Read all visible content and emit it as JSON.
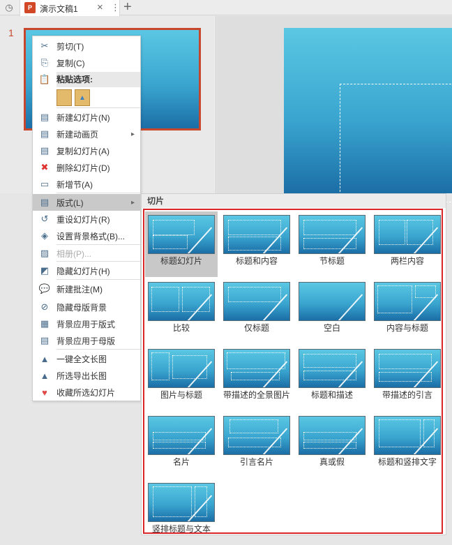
{
  "tabbar": {
    "doc_title": "演示文稿1",
    "close": "×",
    "more": "⋮",
    "new_tab": "+"
  },
  "slide_panel": {
    "slide_number": "1"
  },
  "context_menu": {
    "items": [
      {
        "label": "剪切(T)",
        "icon": "scissors-icon"
      },
      {
        "label": "复制(C)",
        "icon": "copy-icon"
      },
      {
        "label": "粘贴选项:",
        "icon": "paste-icon"
      },
      {
        "label": "新建幻灯片(N)",
        "icon": "new-slide-icon"
      },
      {
        "label": "新建动画页",
        "icon": "new-animation-page-icon"
      },
      {
        "label": "复制幻灯片(A)",
        "icon": "duplicate-slide-icon"
      },
      {
        "label": "删除幻灯片(D)",
        "icon": "delete-slide-icon"
      },
      {
        "label": "新增节(A)",
        "icon": "add-section-icon"
      },
      {
        "label": "版式(L)",
        "icon": "layout-icon"
      },
      {
        "label": "重设幻灯片(R)",
        "icon": "reset-slide-icon"
      },
      {
        "label": "设置背景格式(B)...",
        "icon": "format-background-icon"
      },
      {
        "label": "相册(P)...",
        "icon": "photo-album-icon"
      },
      {
        "label": "隐藏幻灯片(H)",
        "icon": "hide-slide-icon"
      },
      {
        "label": "新建批注(M)",
        "icon": "new-comment-icon"
      },
      {
        "label": "隐藏母版背景",
        "icon": "hide-master-bg-icon"
      },
      {
        "label": "背景应用于版式",
        "icon": "apply-bg-layout-icon"
      },
      {
        "label": "背景应用于母版",
        "icon": "apply-bg-master-icon"
      },
      {
        "label": "一键全文长图",
        "icon": "long-image-icon"
      },
      {
        "label": "所选导出长图",
        "icon": "export-long-image-icon"
      },
      {
        "label": "收藏所选幻灯片",
        "icon": "favorite-icon"
      }
    ]
  },
  "layout_submenu": {
    "header": "切片",
    "layouts": [
      "标题幻灯片",
      "标题和内容",
      "节标题",
      "两栏内容",
      "比较",
      "仅标题",
      "空白",
      "内容与标题",
      "图片与标题",
      "带描述的全景图片",
      "标题和描述",
      "带描述的引言",
      "名片",
      "引言名片",
      "真或假",
      "标题和竖排文字",
      "竖排标题与文本"
    ],
    "selected": "标题幻灯片"
  },
  "colors": {
    "slide_border": "#c8462c",
    "gallery_border": "#d9262b",
    "accent": "#3aa6d0"
  }
}
